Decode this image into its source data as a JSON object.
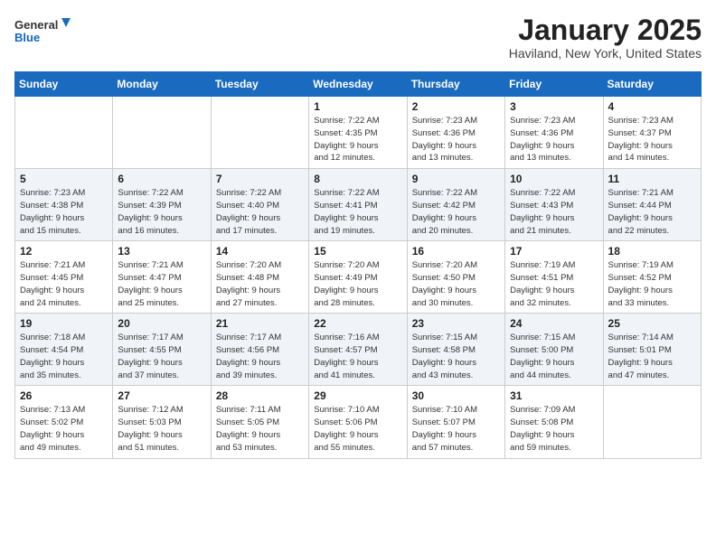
{
  "header": {
    "logo": {
      "general": "General",
      "blue": "Blue"
    },
    "title": "January 2025",
    "location": "Haviland, New York, United States"
  },
  "days_of_week": [
    "Sunday",
    "Monday",
    "Tuesday",
    "Wednesday",
    "Thursday",
    "Friday",
    "Saturday"
  ],
  "weeks": [
    [
      {
        "day": "",
        "info": ""
      },
      {
        "day": "",
        "info": ""
      },
      {
        "day": "",
        "info": ""
      },
      {
        "day": "1",
        "info": "Sunrise: 7:22 AM\nSunset: 4:35 PM\nDaylight: 9 hours\nand 12 minutes."
      },
      {
        "day": "2",
        "info": "Sunrise: 7:23 AM\nSunset: 4:36 PM\nDaylight: 9 hours\nand 13 minutes."
      },
      {
        "day": "3",
        "info": "Sunrise: 7:23 AM\nSunset: 4:36 PM\nDaylight: 9 hours\nand 13 minutes."
      },
      {
        "day": "4",
        "info": "Sunrise: 7:23 AM\nSunset: 4:37 PM\nDaylight: 9 hours\nand 14 minutes."
      }
    ],
    [
      {
        "day": "5",
        "info": "Sunrise: 7:23 AM\nSunset: 4:38 PM\nDaylight: 9 hours\nand 15 minutes."
      },
      {
        "day": "6",
        "info": "Sunrise: 7:22 AM\nSunset: 4:39 PM\nDaylight: 9 hours\nand 16 minutes."
      },
      {
        "day": "7",
        "info": "Sunrise: 7:22 AM\nSunset: 4:40 PM\nDaylight: 9 hours\nand 17 minutes."
      },
      {
        "day": "8",
        "info": "Sunrise: 7:22 AM\nSunset: 4:41 PM\nDaylight: 9 hours\nand 19 minutes."
      },
      {
        "day": "9",
        "info": "Sunrise: 7:22 AM\nSunset: 4:42 PM\nDaylight: 9 hours\nand 20 minutes."
      },
      {
        "day": "10",
        "info": "Sunrise: 7:22 AM\nSunset: 4:43 PM\nDaylight: 9 hours\nand 21 minutes."
      },
      {
        "day": "11",
        "info": "Sunrise: 7:21 AM\nSunset: 4:44 PM\nDaylight: 9 hours\nand 22 minutes."
      }
    ],
    [
      {
        "day": "12",
        "info": "Sunrise: 7:21 AM\nSunset: 4:45 PM\nDaylight: 9 hours\nand 24 minutes."
      },
      {
        "day": "13",
        "info": "Sunrise: 7:21 AM\nSunset: 4:47 PM\nDaylight: 9 hours\nand 25 minutes."
      },
      {
        "day": "14",
        "info": "Sunrise: 7:20 AM\nSunset: 4:48 PM\nDaylight: 9 hours\nand 27 minutes."
      },
      {
        "day": "15",
        "info": "Sunrise: 7:20 AM\nSunset: 4:49 PM\nDaylight: 9 hours\nand 28 minutes."
      },
      {
        "day": "16",
        "info": "Sunrise: 7:20 AM\nSunset: 4:50 PM\nDaylight: 9 hours\nand 30 minutes."
      },
      {
        "day": "17",
        "info": "Sunrise: 7:19 AM\nSunset: 4:51 PM\nDaylight: 9 hours\nand 32 minutes."
      },
      {
        "day": "18",
        "info": "Sunrise: 7:19 AM\nSunset: 4:52 PM\nDaylight: 9 hours\nand 33 minutes."
      }
    ],
    [
      {
        "day": "19",
        "info": "Sunrise: 7:18 AM\nSunset: 4:54 PM\nDaylight: 9 hours\nand 35 minutes."
      },
      {
        "day": "20",
        "info": "Sunrise: 7:17 AM\nSunset: 4:55 PM\nDaylight: 9 hours\nand 37 minutes."
      },
      {
        "day": "21",
        "info": "Sunrise: 7:17 AM\nSunset: 4:56 PM\nDaylight: 9 hours\nand 39 minutes."
      },
      {
        "day": "22",
        "info": "Sunrise: 7:16 AM\nSunset: 4:57 PM\nDaylight: 9 hours\nand 41 minutes."
      },
      {
        "day": "23",
        "info": "Sunrise: 7:15 AM\nSunset: 4:58 PM\nDaylight: 9 hours\nand 43 minutes."
      },
      {
        "day": "24",
        "info": "Sunrise: 7:15 AM\nSunset: 5:00 PM\nDaylight: 9 hours\nand 44 minutes."
      },
      {
        "day": "25",
        "info": "Sunrise: 7:14 AM\nSunset: 5:01 PM\nDaylight: 9 hours\nand 47 minutes."
      }
    ],
    [
      {
        "day": "26",
        "info": "Sunrise: 7:13 AM\nSunset: 5:02 PM\nDaylight: 9 hours\nand 49 minutes."
      },
      {
        "day": "27",
        "info": "Sunrise: 7:12 AM\nSunset: 5:03 PM\nDaylight: 9 hours\nand 51 minutes."
      },
      {
        "day": "28",
        "info": "Sunrise: 7:11 AM\nSunset: 5:05 PM\nDaylight: 9 hours\nand 53 minutes."
      },
      {
        "day": "29",
        "info": "Sunrise: 7:10 AM\nSunset: 5:06 PM\nDaylight: 9 hours\nand 55 minutes."
      },
      {
        "day": "30",
        "info": "Sunrise: 7:10 AM\nSunset: 5:07 PM\nDaylight: 9 hours\nand 57 minutes."
      },
      {
        "day": "31",
        "info": "Sunrise: 7:09 AM\nSunset: 5:08 PM\nDaylight: 9 hours\nand 59 minutes."
      },
      {
        "day": "",
        "info": ""
      }
    ]
  ]
}
